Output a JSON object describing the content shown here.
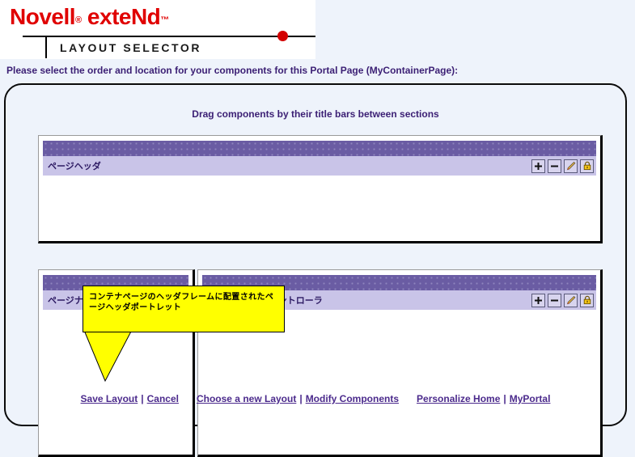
{
  "brand": {
    "logo_primary": "Novell",
    "logo_reg_mark": "®",
    "logo_secondary": "exteNd",
    "logo_tm_mark": "™",
    "subtitle": "LAYOUT SELECTOR",
    "logo_color": "#e00000",
    "dot_color": "#d30000"
  },
  "instruction": "Please select the order and location for your components for this Portal Page (MyContainerPage):",
  "panel": {
    "drag_hint": "Drag components by their title bars between sections"
  },
  "colors": {
    "page_background": "#eef3fb",
    "heading_text": "#3b1f74",
    "portlet_topbar": "#6a5ca3",
    "portlet_titlebar": "#c9c4e8",
    "portlet_title_text": "#2d1a63",
    "link_text": "#4b2a8c",
    "callout_background": "#ffff00"
  },
  "sections": [
    {
      "name": "header-section",
      "portlets": [
        {
          "title": "ページヘッダ",
          "buttons": [
            {
              "icon": "plus-icon",
              "label": "+"
            },
            {
              "icon": "minus-icon",
              "label": "−"
            },
            {
              "icon": "edit-pencil-icon",
              "label": "Edit"
            },
            {
              "icon": "lock-icon",
              "label": "Lock"
            }
          ]
        }
      ]
    },
    {
      "name": "left-section",
      "portlets": [
        {
          "title": "ページナビゲーション",
          "buttons": [
            {
              "icon": "plus-icon",
              "label": "+"
            },
            {
              "icon": "minus-icon",
              "label": "−"
            },
            {
              "icon": "edit-pencil-icon",
              "label": "Edit"
            },
            {
              "icon": "lock-icon",
              "label": "Lock"
            }
          ]
        }
      ]
    },
    {
      "name": "right-section",
      "portlets": [
        {
          "title": "ポータルページコントローラ",
          "buttons": [
            {
              "icon": "plus-icon",
              "label": "+"
            },
            {
              "icon": "minus-icon",
              "label": "−"
            },
            {
              "icon": "edit-pencil-icon",
              "label": "Edit"
            },
            {
              "icon": "lock-icon",
              "label": "Lock"
            }
          ]
        }
      ]
    }
  ],
  "callout": {
    "text": "コンテナページのヘッダフレームに配置されたページヘッダポートレット"
  },
  "footer": {
    "separator": "|",
    "links": [
      {
        "label": "Save Layout"
      },
      {
        "label": "Cancel"
      },
      {
        "label": "Choose a new Layout"
      },
      {
        "label": "Modify Components"
      },
      {
        "label": "Personalize Home"
      },
      {
        "label": "MyPortal"
      }
    ]
  }
}
